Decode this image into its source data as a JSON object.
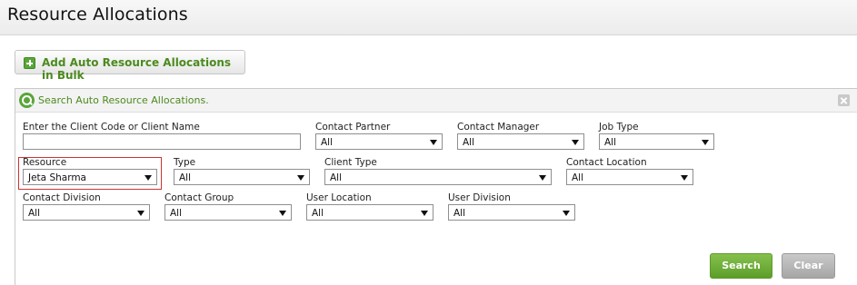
{
  "page": {
    "title": "Resource Allocations"
  },
  "toolbar": {
    "bulk_button_label": "Add Auto Resource Allocations in Bulk"
  },
  "search_panel": {
    "title": "Search Auto Resource Allocations.",
    "fields": {
      "client": {
        "label": "Enter the Client Code or Client Name",
        "value": ""
      },
      "contact_partner": {
        "label": "Contact Partner",
        "value": "All"
      },
      "contact_manager": {
        "label": "Contact Manager",
        "value": "All"
      },
      "job_type": {
        "label": "Job Type",
        "value": "All"
      },
      "resource": {
        "label": "Resource",
        "value": "Jeta Sharma"
      },
      "type": {
        "label": "Type",
        "value": "All"
      },
      "client_type": {
        "label": "Client Type",
        "value": "All"
      },
      "contact_location": {
        "label": "Contact Location",
        "value": "All"
      },
      "contact_division": {
        "label": "Contact Division",
        "value": "All"
      },
      "contact_group": {
        "label": "Contact Group",
        "value": "All"
      },
      "user_location": {
        "label": "User Location",
        "value": "All"
      },
      "user_division": {
        "label": "User Division",
        "value": "All"
      }
    },
    "search_label": "Search",
    "clear_label": "Clear"
  },
  "colors": {
    "accent_green": "#4c8a1e",
    "highlight_border": "#cc3333"
  }
}
